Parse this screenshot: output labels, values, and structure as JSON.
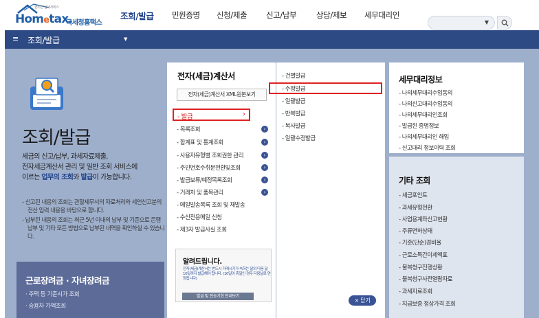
{
  "header": {
    "logo_tagline": "편리한 납세서비스",
    "logo_brand_pre": "Hom",
    "logo_brand_e": "e",
    "logo_brand_post": "tax.",
    "logo_agency": "국세청홈택스",
    "nav": [
      "조회/발급",
      "민원증명",
      "신청/제출",
      "신고/납부",
      "상담/제보",
      "세무대리인"
    ],
    "active_nav": "조회/발급",
    "search_placeholder": ""
  },
  "navbar": {
    "menu_icon": "≡",
    "title": "조회/발급",
    "caret": "▼"
  },
  "hero": {
    "title": "조회/발급",
    "desc_1": "세금의 신고/납부, 과세자료제출,",
    "desc_2": "전자세금계산서 관리 및 일반 조회 서비스에",
    "desc_3_pre": "이르는 ",
    "desc_3_hl1": "업무의 조회",
    "desc_3_mid": "와 ",
    "desc_3_hl2": "발급",
    "desc_3_post": "이 가능합니다.",
    "note_1": "- 신고된 내용의 조회는 관할세무서의 자료처리와 세언신고분의 전산 입력 내용을 바탕으로 합니다.",
    "note_2": "- 납부된 내용의 조회는 최근 5년 이내의 납부 및 기준으로 은행 납부 및 기타 모든 방법으로 납부된 내역을 확인하실 수 있습니다."
  },
  "promo": {
    "title": "근로장려금 · 자녀장려금",
    "links": [
      "· 주택 등 기준시가 조회",
      "· 승용차 가액조회"
    ]
  },
  "center": {
    "title": "전자(세금)계산서",
    "xml_button": "전자(세금)계산서 XML원본보기",
    "issue_label": "- 발급",
    "issue_arrow": "›",
    "menu": [
      "- 목록조회",
      "- 합계표 및 통계조회",
      "- 사용자유형별 조회권한 관리",
      "- 주민번호수취분전환및조회",
      "- 발급보류/예정목록조회",
      "- 거래처 및 품목관리",
      "- 메일발송목록 조회 및 재발송",
      "- 수신전용메일 신청",
      "- 제3자 발급사실 조회"
    ],
    "menu_arrows": [
      true,
      true,
      true,
      true,
      true,
      true,
      false,
      false,
      false
    ]
  },
  "notice": {
    "title": "알려드립니다.",
    "body": "전자(세금)계산서는 반드시 거래시기가 속하는 달의 다음 달 10일까지 발급해야 합니다. (10일이 휴일인 경우 다음날로 연장됩니다)",
    "button": "발급 및 전송기한 안내보기"
  },
  "close_button": "× 닫기",
  "issue_types": [
    "- 건별발급",
    "- 수정발급",
    "- 일괄발급",
    "- 반복발급",
    "- 복사발급",
    "- 일괄수정발급"
  ],
  "right1": {
    "title": "세무대리정보",
    "items": [
      "- 나의세무대리수임동의",
      "- 나의신고대리수임동의",
      "- 나의세무대리인조회",
      "- 발급된 증명정보",
      "- 나의세무대리인 해임",
      "- 신고대리 정보이력 조회"
    ]
  },
  "right2": {
    "title": "기타 조회",
    "items": [
      "- 세금포인트",
      "- 과세유형전환",
      "- 사업용계좌신고현황",
      "- 주류면허상태",
      "- 기준(단순)경비율",
      "- 근로소득간이세액표",
      "- 불복청구진행상황",
      "- 불복청구사전열람자료",
      "- 과세자료조회",
      "- 지급보증 정상가격 조회"
    ]
  },
  "colors": {
    "nav_blue": "#2e4a84",
    "panel_bg": "#9eafcb",
    "highlight_red": "#e02020",
    "promo_bg": "#5c6b98"
  }
}
